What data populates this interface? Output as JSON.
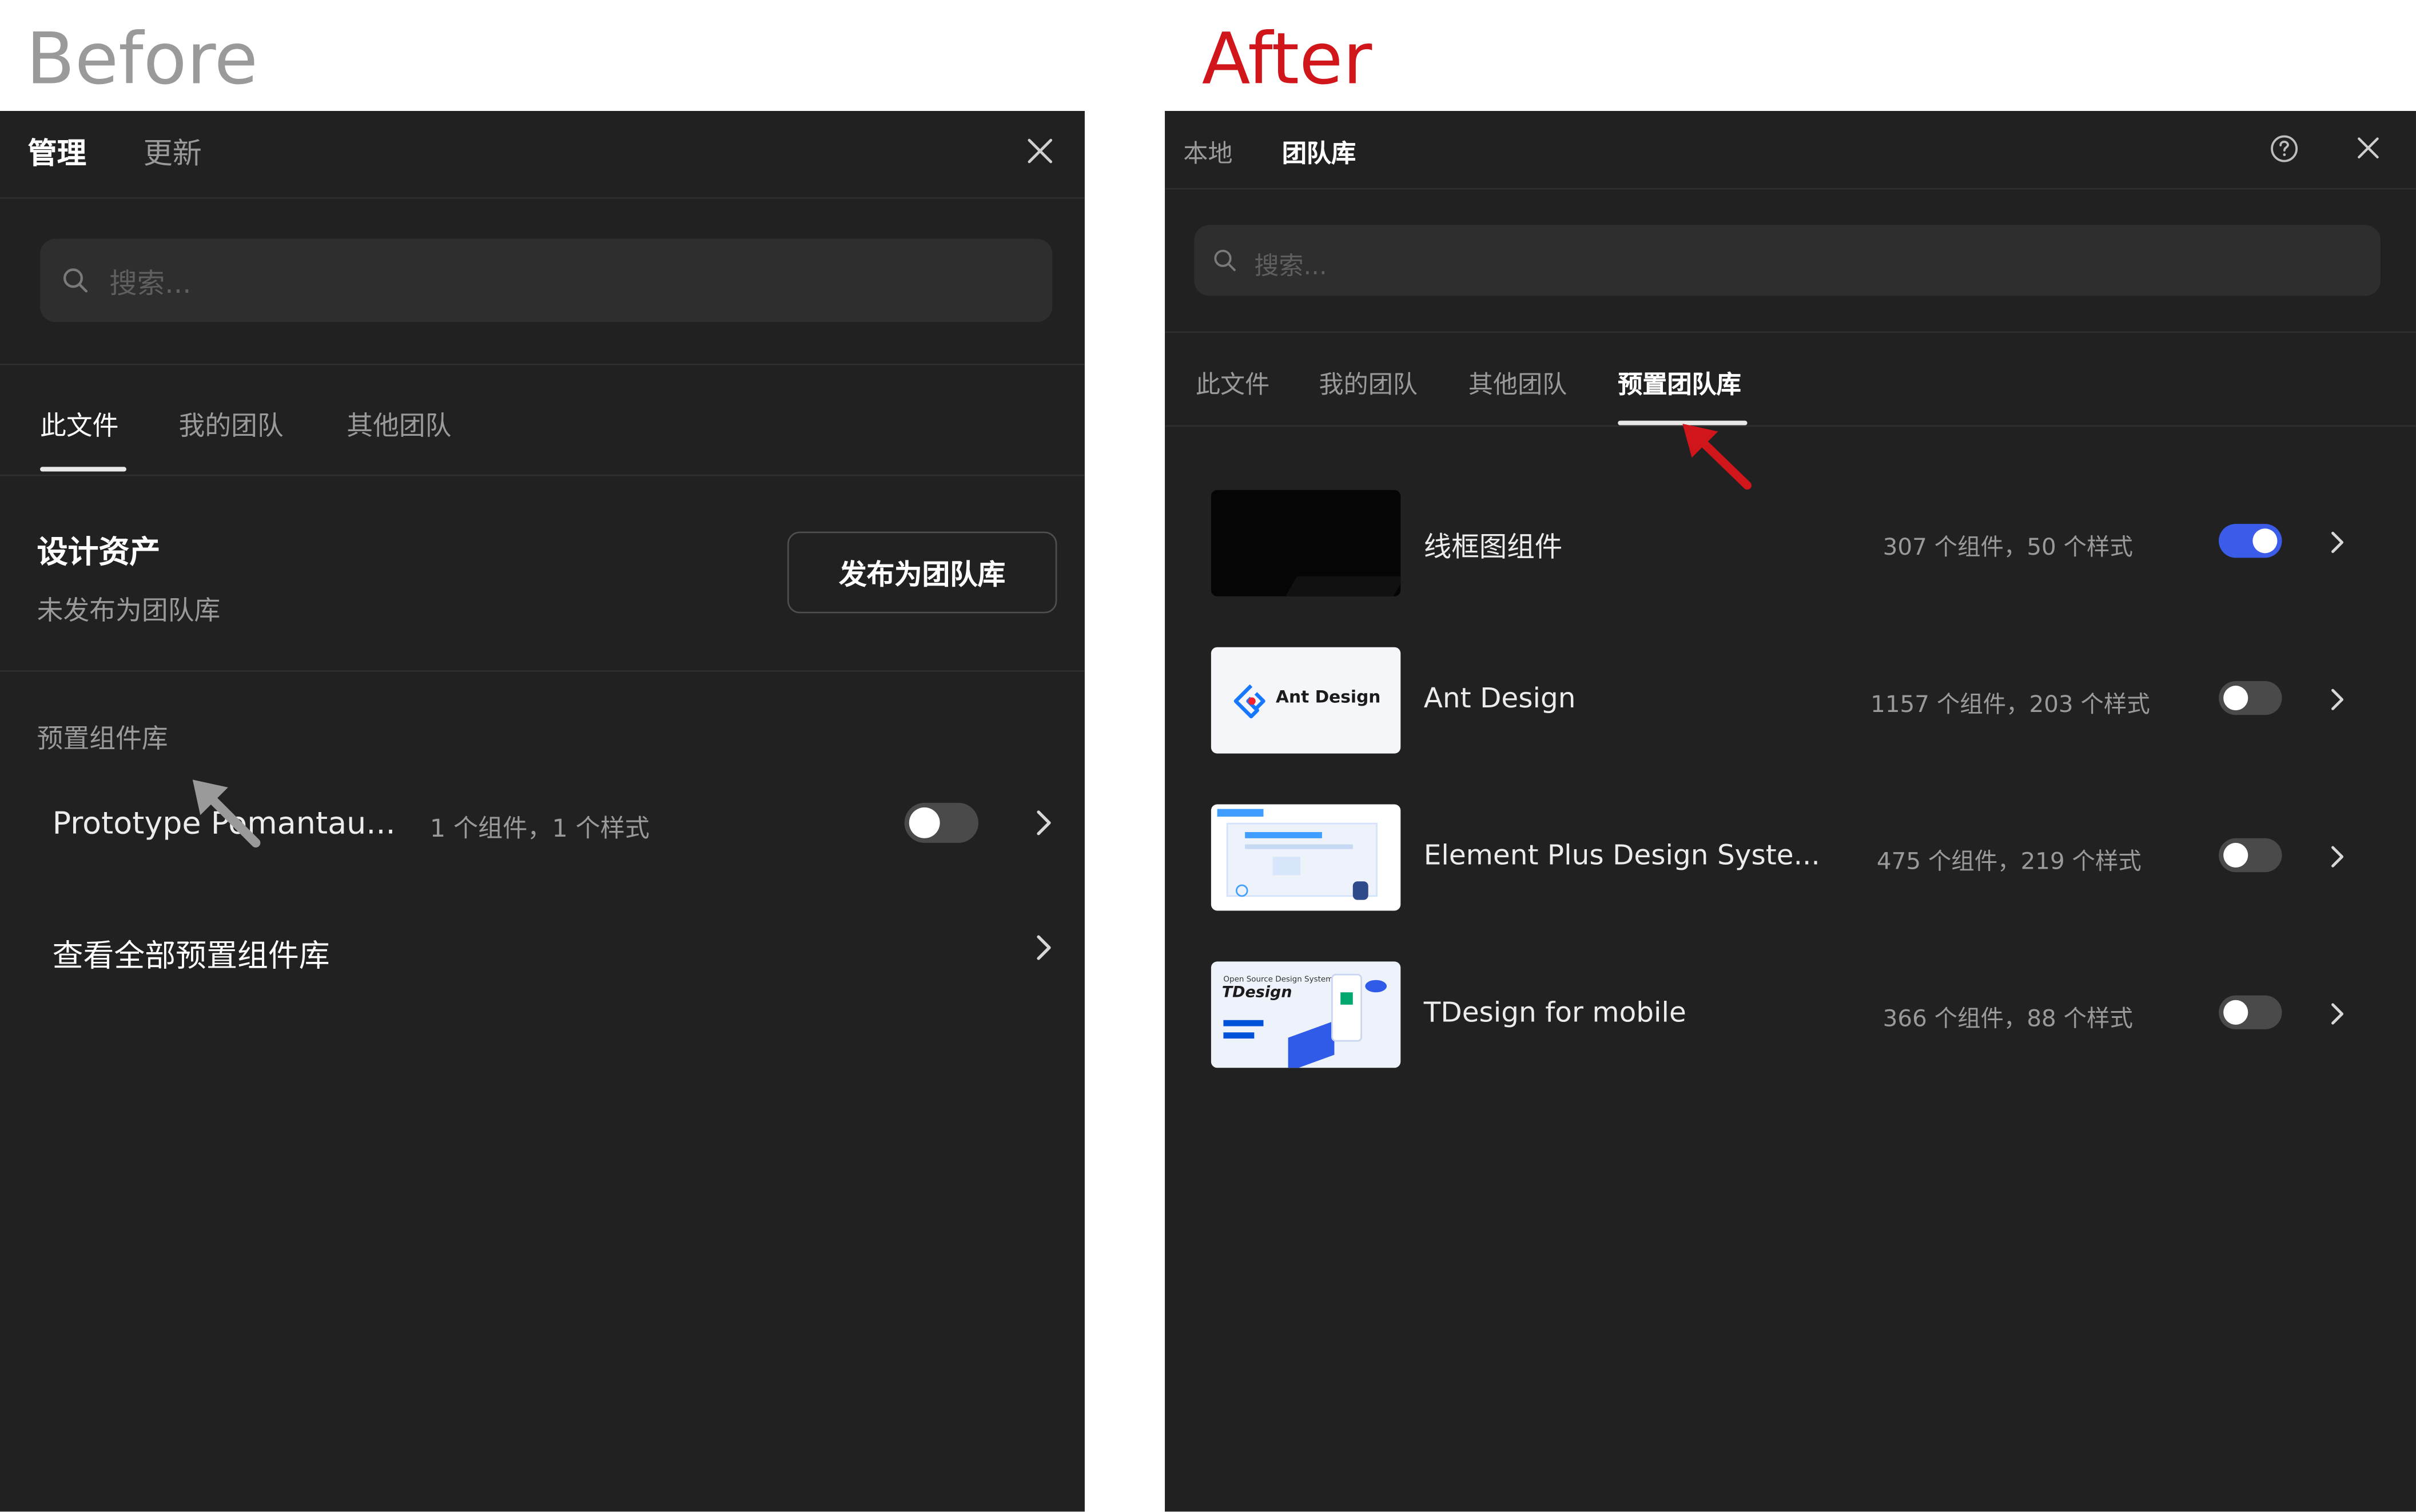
{
  "before": {
    "heading": "Before",
    "heading_color": "#9a9a9a",
    "tabs": [
      "管理",
      "更新"
    ],
    "search_placeholder": "搜索...",
    "subtabs": [
      "此文件",
      "我的团队",
      "其他团队"
    ],
    "assets_title": "设计资产",
    "assets_subtitle": "未发布为团队库",
    "publish_button": "发布为团队库",
    "preset_section": "预置组件库",
    "preset_item": {
      "name": "Prototype Pomantau...",
      "meta": "1 个组件，1 个样式",
      "enabled": false
    },
    "view_all": "查看全部预置组件库"
  },
  "after": {
    "heading": "After",
    "heading_color": "#d0161b",
    "tabs": [
      "本地",
      "团队库"
    ],
    "search_placeholder": "搜索...",
    "subtabs": [
      "此文件",
      "我的团队",
      "其他团队",
      "预置团队库"
    ],
    "libraries": [
      {
        "name": "线框图组件",
        "meta": "307 个组件，50 个样式",
        "enabled": true,
        "thumb": "wireframe"
      },
      {
        "name": "Ant Design",
        "meta": "1157 个组件，203 个样式",
        "enabled": false,
        "thumb": "antd",
        "thumb_text": "Ant Design"
      },
      {
        "name": "Element Plus Design Syste...",
        "meta": "475 个组件，219 个样式",
        "enabled": false,
        "thumb": "element"
      },
      {
        "name": "TDesign for mobile",
        "meta": "366 个组件，88 个样式",
        "enabled": false,
        "thumb": "tdesign",
        "thumb_text_1": "Open Source Design System",
        "thumb_text_2": "TDesign"
      }
    ]
  },
  "colors": {
    "panel_bg": "#212121",
    "search_bg": "#2e2e2e",
    "toggle_on": "#3b5ce8",
    "toggle_off": "#4a4a4a",
    "annotation_arrow_before": "#9a9a9a",
    "annotation_arrow_after": "#d0161b"
  }
}
